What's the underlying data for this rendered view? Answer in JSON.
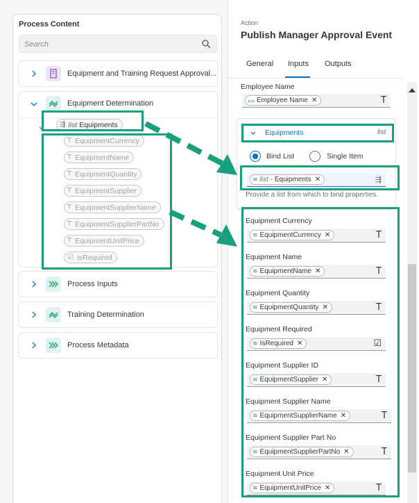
{
  "left": {
    "title": "Process Content",
    "search_placeholder": "Search",
    "items": [
      {
        "label": "Equipment and Training Request Approval..."
      },
      {
        "label": "Equipment Determination"
      },
      {
        "label": "Process Inputs"
      },
      {
        "label": "Training Determination"
      },
      {
        "label": "Process Metadata"
      }
    ],
    "list_chip": {
      "prefix": "list",
      "label": "Equipments"
    },
    "fields": [
      "EquipmentCurrency",
      "EquipmentName",
      "EquipmentQuantity",
      "EquipmentSupplier",
      "EquipmentSupplierName",
      "EquipmentSupplierPartNo",
      "EquipmentUnitPrice",
      "IsRequired"
    ]
  },
  "right": {
    "action_label": "Action",
    "action_title": "Publish Manager Approval Event",
    "tabs": [
      "General",
      "Inputs",
      "Outputs"
    ],
    "active_tab": "Inputs",
    "employee": {
      "label": "Employee Name",
      "value": "Employee Name"
    },
    "group": {
      "title": "Equipments",
      "type": "list",
      "bind_list": "Bind List",
      "single_item": "Single Item",
      "bound_prefix": "list",
      "bound_value": "- Equipments",
      "help": "Provide a list from which to bind properties."
    },
    "fields": [
      {
        "label": "Equipment Currency",
        "value": "EquipmentCurrency",
        "type": "T"
      },
      {
        "label": "Equipment Name",
        "value": "EquipmentName",
        "type": "T"
      },
      {
        "label": "Equipment Quantity",
        "value": "EquipmentQuantity",
        "type": "T"
      },
      {
        "label": "Equipment Required",
        "value": "IsRequired",
        "type": "☑"
      },
      {
        "label": "Equipment Supplier ID",
        "value": "EquipmentSupplier",
        "type": "T"
      },
      {
        "label": "Equipment Supplier Name",
        "value": "EquipmentSupplierName",
        "type": "T"
      },
      {
        "label": "Equipment Supplier Part No",
        "value": "EquipmentSupplierPartNo",
        "type": "T"
      },
      {
        "label": "Equipment Unit Price",
        "value": "EquipmentUnitPrice",
        "type": "T"
      }
    ]
  },
  "colors": {
    "highlight": "#17a07b",
    "accent": "#0a6ed1"
  }
}
